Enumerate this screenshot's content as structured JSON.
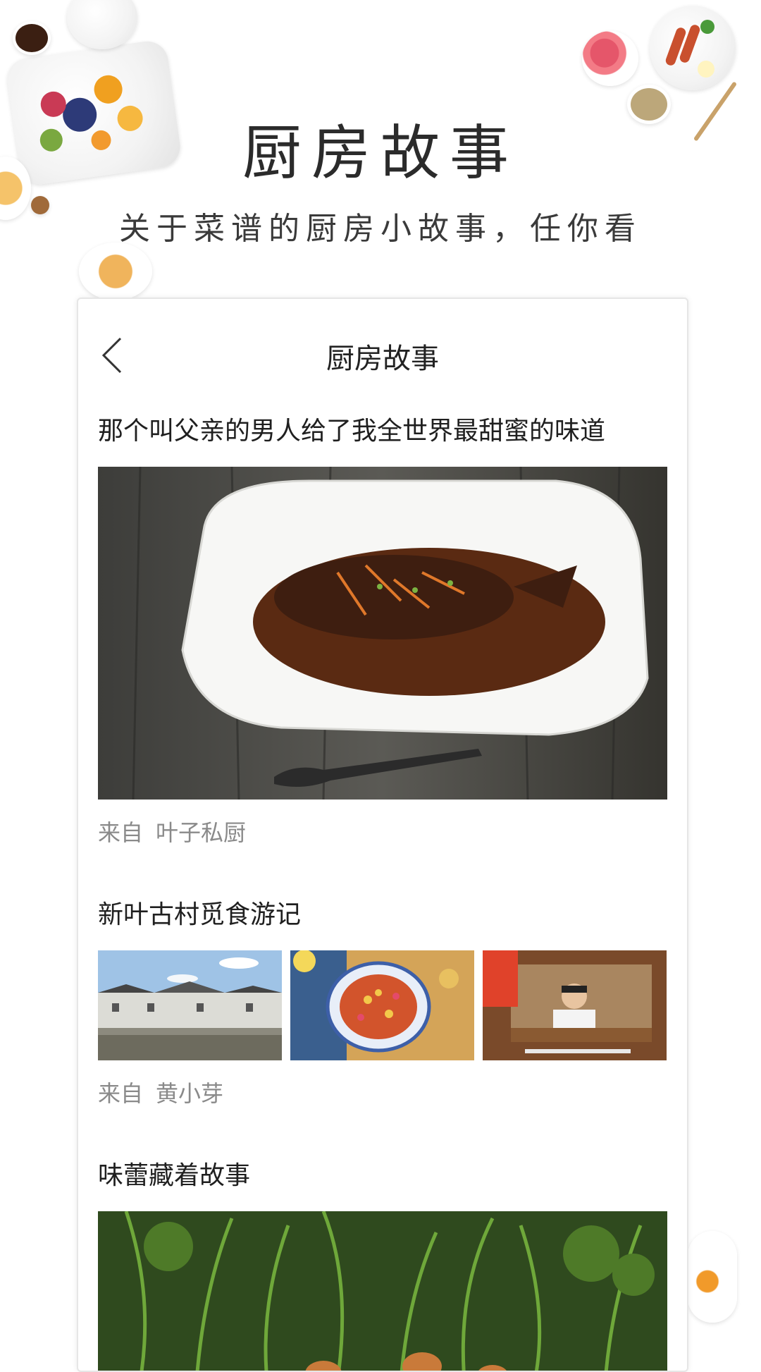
{
  "promo": {
    "title": "厨房故事",
    "subtitle": "关于菜谱的厨房小故事，任你看"
  },
  "app": {
    "nav_title": "厨房故事",
    "back_icon": "chevron-left-icon"
  },
  "stories": [
    {
      "title": "那个叫父亲的男人给了我全世界最甜蜜的味道",
      "source_prefix": "来自",
      "source_name": "叶子私厨"
    },
    {
      "title": "新叶古村觅食游记",
      "source_prefix": "来自",
      "source_name": "黄小芽"
    },
    {
      "title": "味蕾藏着故事"
    }
  ],
  "colors": {
    "title_text": "#2b2b2b",
    "source_text": "#8a8a8a",
    "card_border": "#e6e6e6"
  }
}
